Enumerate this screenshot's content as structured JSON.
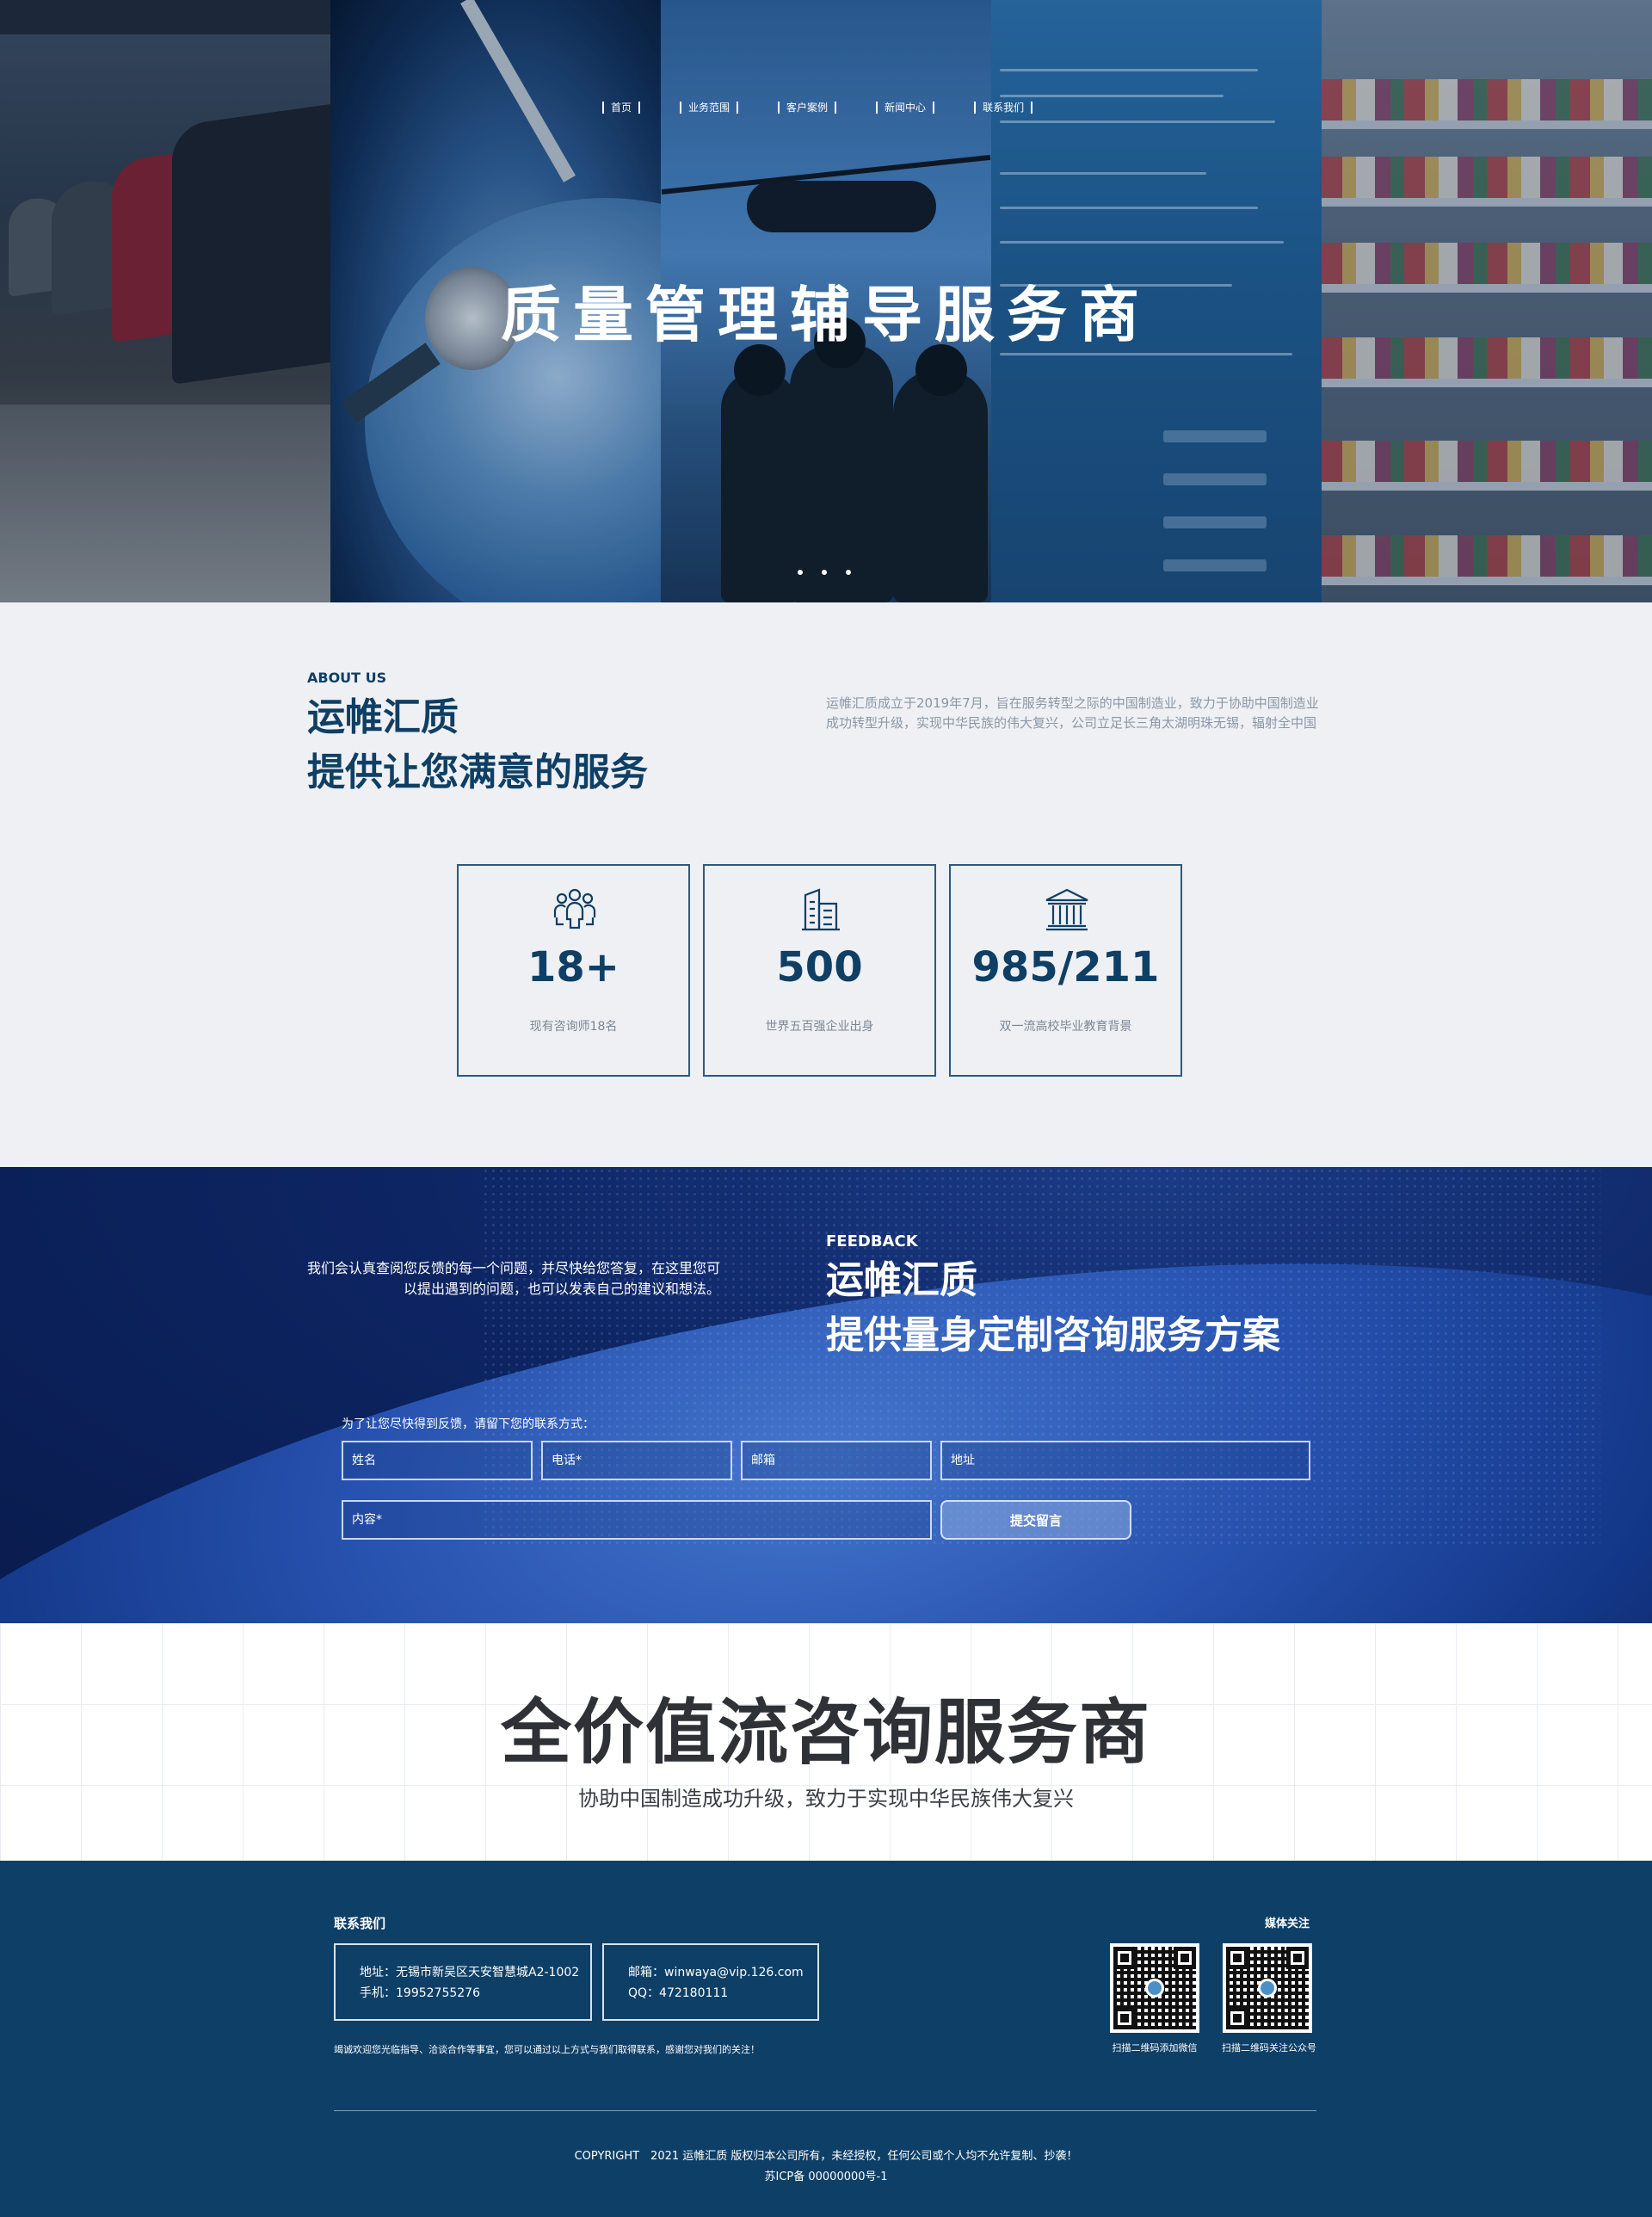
{
  "nav": {
    "items": [
      "首页",
      "业务范围",
      "客户案例",
      "新闻中心",
      "联系我们"
    ]
  },
  "hero": {
    "title": "质量管理辅导服务商"
  },
  "about": {
    "eyebrow": "ABOUT US",
    "title_line1": "运帷汇质",
    "title_line2": "提供让您满意的服务",
    "description": "运帷汇质成立于2019年7月，旨在服务转型之际的中国制造业，致力于协助中国制造业成功转型升级，实现中华民族的伟大复兴，公司立足长三角太湖明珠无锡，辐射全中国",
    "stats": [
      {
        "icon": "people-icon",
        "value": "18+",
        "label": "现有咨询师18名"
      },
      {
        "icon": "buildings-icon",
        "value": "500",
        "label": "世界五百强企业出身"
      },
      {
        "icon": "university-icon",
        "value": "985/211",
        "label": "双一流高校毕业教育背景"
      }
    ]
  },
  "feedback": {
    "intro_line1": "我们会认真查阅您反馈的每一个问题，并尽快给您答复，在这里您可",
    "intro_line2": "以提出遇到的问题，也可以发表自己的建议和想法。",
    "eyebrow": "FEEDBACK",
    "title_line1": "运帷汇质",
    "title_line2": "提供量身定制咨询服务方案",
    "form_hint": "为了让您尽快得到反馈，请留下您的联系方式：",
    "placeholders": {
      "name": "姓名",
      "phone": "电话*",
      "email": "邮箱",
      "address": "地址",
      "content": "内容*"
    },
    "submit_label": "提交留言"
  },
  "slogan": {
    "title": "全价值流咨询服务商",
    "subtitle": "协助中国制造成功升级，致力于实现中华民族伟大复兴"
  },
  "footer": {
    "contact_heading": "联系我们",
    "media_heading": "媒体关注",
    "address": "地址：无锡市新吴区天安智慧城A2-1002",
    "phone": "手机：19952755276",
    "email": "邮箱：winwaya@vip.126.com",
    "qq": "QQ：472180111",
    "note": "竭诚欢迎您光临指导、洽谈合作等事宜，您可以通过以上方式与我们取得联系，感谢您对我们的关注！",
    "qr1_label": "扫描二维码添加微信",
    "qr2_label": "扫描二维码关注公众号",
    "copyright": "COPYRIGHT　2021 运帷汇质 版权归本公司所有，未经授权，任何公司或个人均不允许复制、抄袭！",
    "icp": "苏ICP备 00000000号-1"
  },
  "colors": {
    "primary": "#0f3f64",
    "footer_bg": "#0e3f67",
    "feedback_bg": "#0d2563"
  }
}
